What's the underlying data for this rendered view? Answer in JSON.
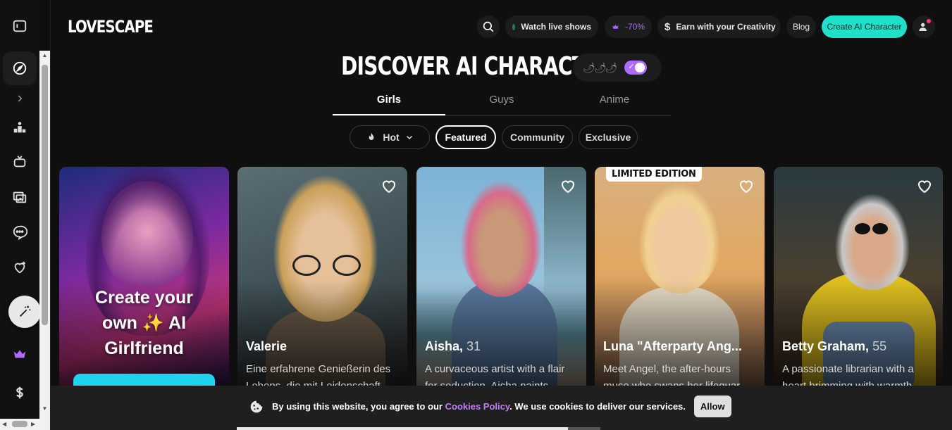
{
  "brand": {
    "logo": "LOVESCAPE"
  },
  "header": {
    "watch_live": "Watch live shows",
    "discount": "-70%",
    "earn": "Earn with your Creativity",
    "blog": "Blog",
    "create": "Create AI Character"
  },
  "page": {
    "title": "DISCOVER AI CHARACTERS",
    "tabs": [
      "Girls",
      "Guys",
      "Anime"
    ],
    "filters": {
      "sort": "Hot",
      "featured": "Featured",
      "community": "Community",
      "exclusive": "Exclusive"
    }
  },
  "create_card": {
    "line1": "Create your",
    "line2": "own ✨ AI",
    "line3": "Girlfriend"
  },
  "cards": [
    {
      "name": "Valerie",
      "age": "",
      "desc": "Eine erfahrene Genießerin des Lebens, die mit Leidenschaft",
      "badge": ""
    },
    {
      "name": "Aisha,",
      "age": "31",
      "desc": "A curvaceous artist with a flair for seduction. Aisha paints",
      "badge": ""
    },
    {
      "name": "Luna \"Afterparty Ang...",
      "age": "",
      "desc": "Meet Angel, the after-hours muse who swaps her lifeguar",
      "badge": "LIMITED EDITION"
    },
    {
      "name": "Betty Graham,",
      "age": "55",
      "desc": "A passionate librarian with a heart brimming with warmth",
      "badge": ""
    }
  ],
  "cookie": {
    "text_before": "By using this website, you agree to our",
    "policy": "Cookies Policy",
    "text_after": ". We use cookies to deliver our services.",
    "allow": "Allow"
  },
  "colors": {
    "accent_teal": "#1fe0c8",
    "accent_purple": "#b06aff",
    "bg": "#0f0f0f"
  }
}
